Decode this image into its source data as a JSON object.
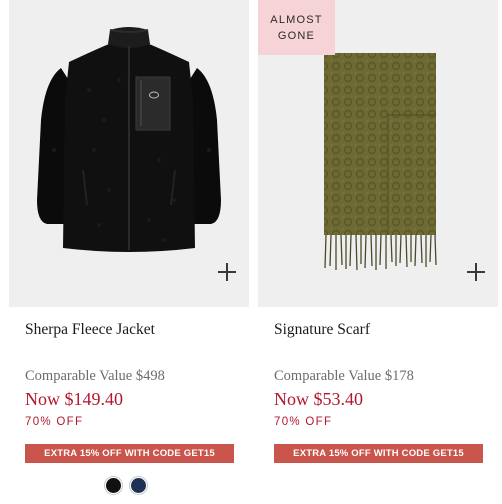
{
  "products": [
    {
      "name": "Sherpa Fleece Jacket",
      "comparable": "Comparable Value $498",
      "now": "Now $149.40",
      "percent_off": "70% OFF",
      "promo": "EXTRA 15% OFF WITH CODE GET15",
      "swatches": [
        {
          "color": "#111111"
        },
        {
          "color": "#1e3054"
        }
      ]
    },
    {
      "badge": "ALMOST\nGONE",
      "name": "Signature Scarf",
      "comparable": "Comparable Value $178",
      "now": "Now $53.40",
      "percent_off": "70% OFF",
      "promo": "EXTRA 15% OFF WITH CODE GET15"
    }
  ],
  "colors": {
    "sale_red": "#b3172d",
    "promo_bg": "#c9554c",
    "badge_bg": "#f6d3d6",
    "image_bg": "#efefef"
  }
}
